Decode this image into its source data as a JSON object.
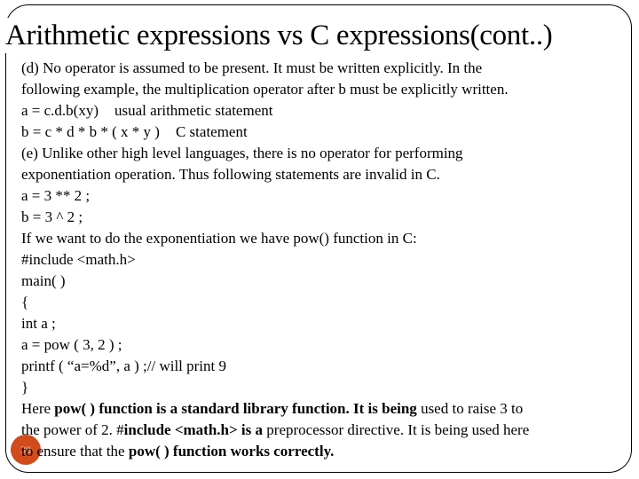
{
  "slide": {
    "title": "Arithmetic expressions vs C expressions(cont..)",
    "slide_number": "38",
    "accent_color": "#d24b1d",
    "lines": {
      "d1": "(d) No operator is assumed to be present. It must be written explicitly. In the",
      "d2": "following example, the multiplication operator after b must be explicitly written.",
      "ex1_code": "a = c.d.b(xy)",
      "ex1_note": "usual arithmetic statement",
      "ex2_code": "b = c * d * b * ( x * y )",
      "ex2_note": "C statement",
      "e1": "(e) Unlike other high level languages, there is no operator for performing",
      "e2": "exponentiation operation. Thus following statements are invalid in C.",
      "inv1": "a = 3 ** 2 ;",
      "inv2": "b = 3 ^ 2 ;",
      "pow_intro": "If we want to do the exponentiation we have pow() function in C:",
      "code": [
        "#include <math.h>",
        "main( )",
        "{",
        "int a ;",
        "a = pow ( 3, 2 ) ;",
        "printf ( “a=%d”, a ) ;// will print 9",
        "}"
      ],
      "p1": {
        "a": "Here ",
        "b_bold": "pow( ) function is a standard library function. It is being",
        "c": " used to raise 3 to"
      },
      "p2": {
        "a": "the power of 2. #",
        "b_bold": "include <math.h> is a",
        "c": " preprocessor directive. It is being used here"
      },
      "p3": {
        "a": "to ensure that the ",
        "b_bold": "pow( ) function works correctly."
      }
    }
  }
}
